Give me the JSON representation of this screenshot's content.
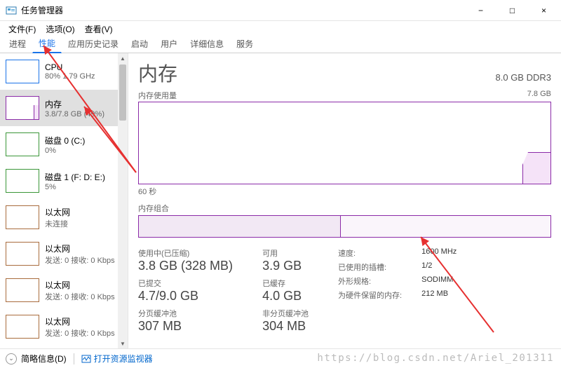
{
  "window": {
    "title": "任务管理器",
    "minimize": "−",
    "maximize": "□",
    "close": "×"
  },
  "menu": {
    "file": "文件(F)",
    "options": "选项(O)",
    "view": "查看(V)"
  },
  "tabs": {
    "processes": "进程",
    "performance": "性能",
    "app_history": "应用历史记录",
    "startup": "启动",
    "users": "用户",
    "details": "详细信息",
    "services": "服务"
  },
  "sidebar": {
    "items": [
      {
        "name": "CPU",
        "sub": "80% 1.79 GHz"
      },
      {
        "name": "内存",
        "sub": "3.8/7.8 GB (49%)"
      },
      {
        "name": "磁盘 0 (C:)",
        "sub": "0%"
      },
      {
        "name": "磁盘 1 (F: D: E:)",
        "sub": "5%"
      },
      {
        "name": "以太网",
        "sub": "未连接"
      },
      {
        "name": "以太网",
        "sub": "发送: 0 接收: 0 Kbps"
      },
      {
        "name": "以太网",
        "sub": "发送: 0 接收: 0 Kbps"
      },
      {
        "name": "以太网",
        "sub": "发送: 0 接收: 0 Kbps"
      }
    ]
  },
  "main": {
    "title": "内存",
    "capacity": "8.0 GB DDR3",
    "usage_label": "内存使用量",
    "usage_max": "7.8 GB",
    "timeline": "60 秒",
    "comp_label": "内存组合"
  },
  "stats_left": {
    "in_use_label": "使用中(已压缩)",
    "in_use_value": "3.8 GB (328 MB)",
    "committed_label": "已提交",
    "committed_value": "4.7/9.0 GB",
    "paged_label": "分页缓冲池",
    "paged_value": "307 MB"
  },
  "stats_mid": {
    "available_label": "可用",
    "available_value": "3.9 GB",
    "cached_label": "已缓存",
    "cached_value": "4.0 GB",
    "nonpaged_label": "非分页缓冲池",
    "nonpaged_value": "304 MB"
  },
  "stats_right": {
    "speed_k": "速度:",
    "speed_v": "1600 MHz",
    "slots_k": "已使用的插槽:",
    "slots_v": "1/2",
    "form_k": "外形规格:",
    "form_v": "SODIMM",
    "reserved_k": "为硬件保留的内存:",
    "reserved_v": "212 MB"
  },
  "footer": {
    "fewer": "简略信息(D)",
    "resmon": "打开资源监视器"
  },
  "watermark": "https://blog.csdn.net/Ariel_201311"
}
